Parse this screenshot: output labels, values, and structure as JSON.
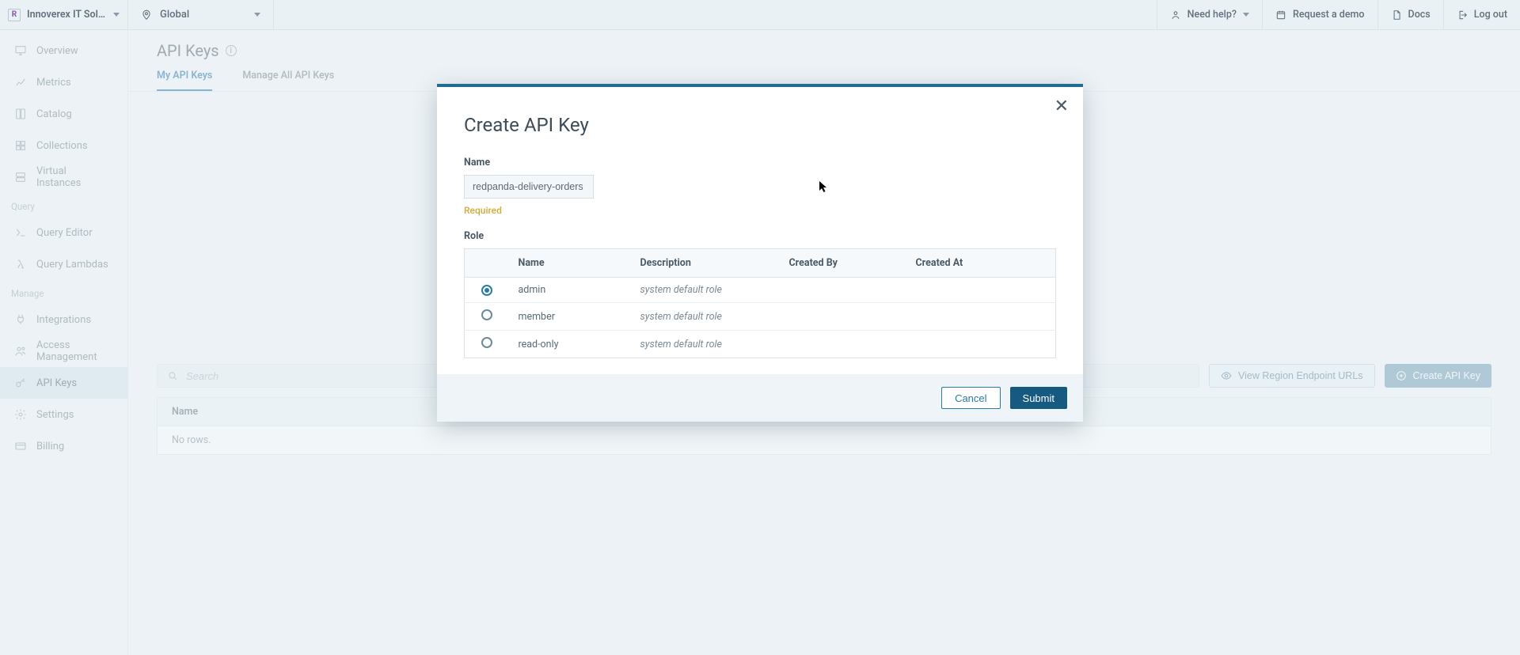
{
  "topbar": {
    "org_name": "Innoverex IT Solution...",
    "org_initial": "R",
    "region": "Global",
    "need_help": "Need help?",
    "request_demo": "Request a demo",
    "docs": "Docs",
    "logout": "Log out"
  },
  "sidebar": {
    "sections": {
      "query": "Query",
      "manage": "Manage"
    },
    "items": {
      "overview": "Overview",
      "metrics": "Metrics",
      "catalog": "Catalog",
      "collections": "Collections",
      "virtual_instances": "Virtual Instances",
      "query_editor": "Query Editor",
      "query_lambdas": "Query Lambdas",
      "integrations": "Integrations",
      "access_management": "Access Management",
      "api_keys": "API Keys",
      "settings": "Settings",
      "billing": "Billing"
    }
  },
  "page": {
    "title": "API Keys",
    "tabs": {
      "my": "My API Keys",
      "all": "Manage All API Keys"
    },
    "search_placeholder": "Search",
    "view_endpoints": "View Region Endpoint URLs",
    "create_key": "Create API Key",
    "table_header_name": "Name",
    "empty_rows": "No rows."
  },
  "modal": {
    "title": "Create API Key",
    "name_label": "Name",
    "name_value": "redpanda-delivery-orders",
    "required": "Required",
    "role_label": "Role",
    "columns": {
      "name": "Name",
      "description": "Description",
      "created_by": "Created By",
      "created_at": "Created At"
    },
    "roles": [
      {
        "name": "admin",
        "description": "system default role",
        "selected": true
      },
      {
        "name": "member",
        "description": "system default role",
        "selected": false
      },
      {
        "name": "read-only",
        "description": "system default role",
        "selected": false
      }
    ],
    "cancel": "Cancel",
    "submit": "Submit"
  }
}
